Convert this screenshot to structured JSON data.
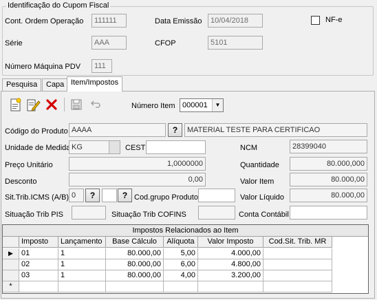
{
  "group": {
    "title": "Identificação do Cupom Fiscal",
    "cont_ordem_label": "Cont. Ordem Operação",
    "cont_ordem_value": "111111",
    "data_emissao_label": "Data Emissão",
    "data_emissao_value": "10/04/2018",
    "nfe_label": "NF-e",
    "serie_label": "Série",
    "serie_value": "AAA",
    "cfop_label": "CFOP",
    "cfop_value": "5101",
    "num_pdv_label": "Número Máquina PDV",
    "num_pdv_value": "111"
  },
  "tabs": [
    {
      "label": "Pesquisa"
    },
    {
      "label": "Capa"
    },
    {
      "label": "Item/Impostos"
    }
  ],
  "toolbar": {
    "numero_item_label": "Número Item",
    "numero_item_value": "000001",
    "icons": [
      "new-document-icon",
      "edit-icon",
      "delete-icon",
      "save-icon",
      "undo-icon"
    ]
  },
  "item": {
    "codigo_label": "Código do Produto",
    "codigo_value": "AAAA",
    "lookup_label": "?",
    "descricao_value": "MATERIAL TESTE PARA CERTIFICAO",
    "unidade_label": "Unidade de Medida",
    "unidade_value": "KG",
    "cest_label": "CEST",
    "cest_value": "",
    "ncm_label": "NCM",
    "ncm_value": "28399040",
    "preco_label": "Preço Unitário",
    "preco_value": "1,0000000",
    "quantidade_label": "Quantidade",
    "quantidade_value": "80.000,000",
    "desconto_label": "Desconto",
    "desconto_value": "0,00",
    "valor_item_label": "Valor Item",
    "valor_item_value": "80.000,00",
    "sit_trib_label": "Sit.Trib.ICMS (A/B)",
    "sit_trib_a": "0",
    "sit_trib_b": "",
    "cod_grupo_label": "Cod.grupo Produto",
    "cod_grupo_value": "",
    "valor_liquido_label": "Valor Líquido",
    "valor_liquido_value": "80.000,00",
    "sit_pis_label": "Situação Trib PIS",
    "sit_pis_value": "",
    "sit_cofins_label": "Situação Trib COFINS",
    "sit_cofins_value": "",
    "conta_contabil_label": "Conta Contábil",
    "conta_contabil_value": ""
  },
  "grid": {
    "title": "Impostos Relacionados ao Item",
    "columns": [
      "Imposto",
      "Lançamento",
      "Base Cálculo",
      "Alíquota",
      "Valor Imposto",
      "Cod.Sit. Trib. MR"
    ],
    "rows": [
      [
        "01",
        "1",
        "80.000,00",
        "5,00",
        "4.000,00",
        ""
      ],
      [
        "02",
        "1",
        "80.000,00",
        "6,00",
        "4.800,00",
        ""
      ],
      [
        "03",
        "1",
        "80.000,00",
        "4,00",
        "3.200,00",
        ""
      ]
    ],
    "new_row_marker": "*",
    "current_row_marker": "▶"
  }
}
